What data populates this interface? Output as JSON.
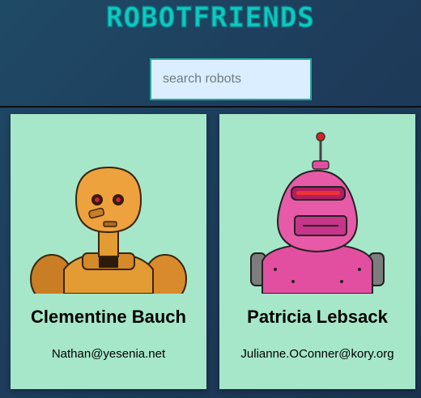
{
  "app": {
    "title": "ROBOTFRIENDS"
  },
  "search": {
    "placeholder": "search robots",
    "value": ""
  },
  "robots": [
    {
      "name": "Clementine Bauch",
      "email": "Nathan@yesenia.net",
      "color": "#e39b34"
    },
    {
      "name": "Patricia Lebsack",
      "email": "Julianne.OConner@kory.org",
      "color": "#e34fa0"
    }
  ]
}
